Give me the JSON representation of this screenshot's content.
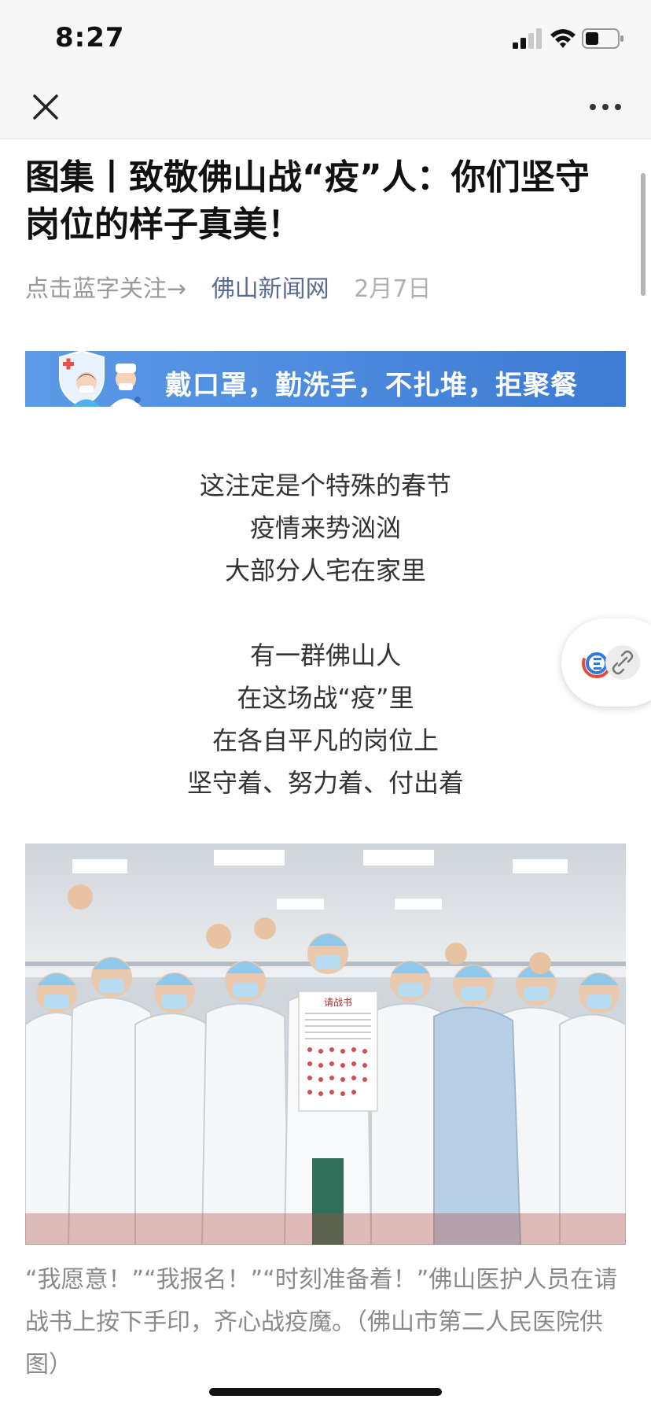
{
  "status_bar": {
    "time": "8:27"
  },
  "article": {
    "title": "图集丨致敬佛山战“疫”人：你们坚守岗位的样子真美！",
    "meta": {
      "follow_hint": "点击蓝字关注→",
      "account": "佛山新闻网",
      "date": "2月7日"
    },
    "banner_text": "戴口罩，勤洗手，不扎堆，拒聚餐",
    "poem_lines": [
      "这注定是个特殊的春节",
      "疫情来势汹汹",
      "大部分人宅在家里",
      "有一群佛山人",
      "在这场战“疫”里",
      "在各自平凡的岗位上",
      "坚守着、努力着、付出着"
    ],
    "photo_sign_title": "请战书",
    "caption": "“我愿意！”“我报名！”“时刻准备着！”佛山医护人员在请战书上按下手印，齐心战疫魔。（佛山市第二人民医院供图）"
  },
  "colors": {
    "account_link": "#576b95",
    "banner_bg": "#4a8ae0",
    "meta_gray": "#9a9a9a"
  },
  "icons": [
    "close-icon",
    "more-icon",
    "signal-icon",
    "wifi-icon",
    "battery-icon",
    "link-icon"
  ]
}
